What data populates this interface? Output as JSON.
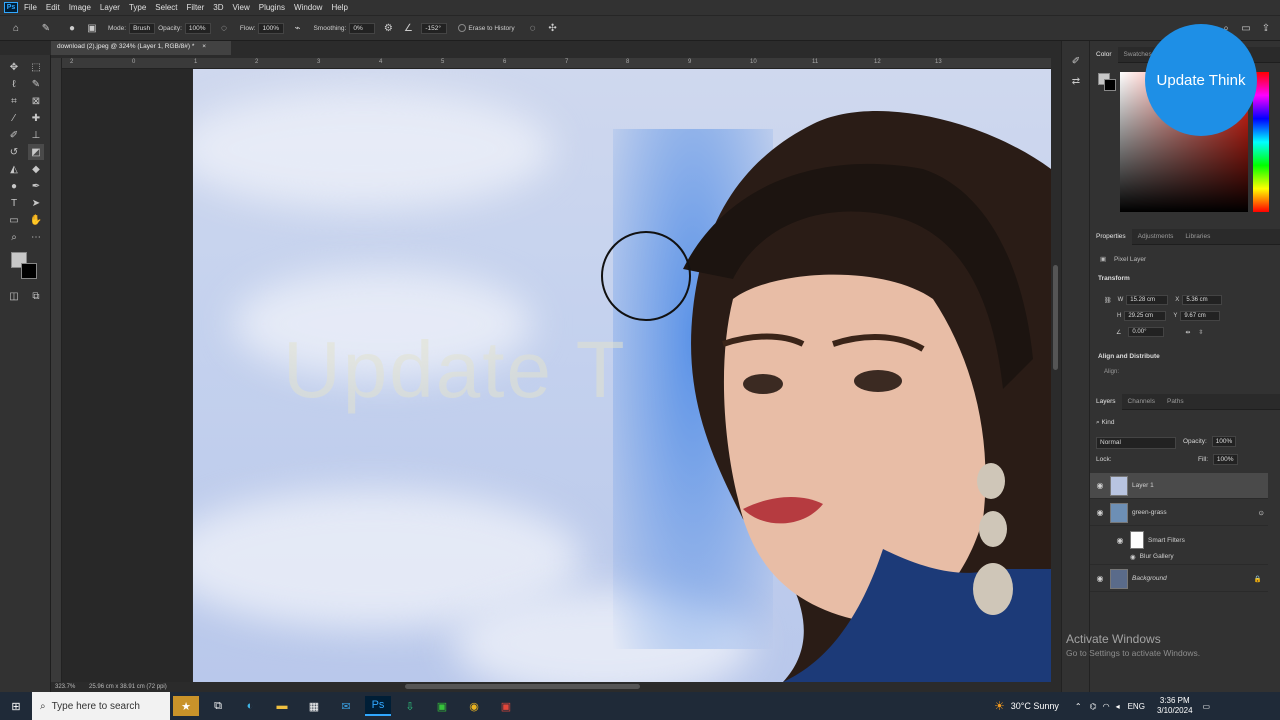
{
  "menu": [
    "File",
    "Edit",
    "Image",
    "Layer",
    "Type",
    "Select",
    "Filter",
    "3D",
    "View",
    "Plugins",
    "Window",
    "Help"
  ],
  "options": {
    "mode_label": "Mode:",
    "mode_value": "Brush",
    "opacity_label": "Opacity:",
    "opacity_value": "100%",
    "flow_label": "Flow:",
    "flow_value": "100%",
    "smoothing_label": "Smoothing:",
    "smoothing_value": "0%",
    "angle_value": "-152°",
    "erase_history": "Erase to History"
  },
  "document": {
    "tab_title": "download (2).jpeg @ 324% (Layer 1, RGB/8#) *",
    "zoom": "323.7%",
    "size": "25.96 cm x 38.91 cm (72 ppi)"
  },
  "ruler_labels": [
    "2",
    "0",
    "1",
    "2",
    "3",
    "4",
    "5",
    "6",
    "7",
    "8",
    "9",
    "10",
    "11",
    "12",
    "13"
  ],
  "watermark": "Update T",
  "badge": "Update Think",
  "color_tabs": [
    "Color",
    "Swatches"
  ],
  "properties": {
    "tabs": [
      "Properties",
      "Adjustments",
      "Libraries"
    ],
    "layer_type": "Pixel Layer",
    "transform_title": "Transform",
    "w_label": "W",
    "w_value": "15.28 cm",
    "x_label": "X",
    "x_value": "5.36 cm",
    "h_label": "H",
    "h_value": "29.25 cm",
    "y_label": "Y",
    "y_value": "9.67 cm",
    "angle_value": "0.00°",
    "align_title": "Align and Distribute",
    "align_label": "Align:"
  },
  "layers_panel": {
    "tabs": [
      "Layers",
      "Channels",
      "Paths"
    ],
    "filter": "Kind",
    "blend": "Normal",
    "opacity_label": "Opacity:",
    "opacity_value": "100%",
    "lock_label": "Lock:",
    "fill_label": "Fill:",
    "fill_value": "100%",
    "layers": [
      {
        "name": "Layer 1"
      },
      {
        "name": "green-grass"
      },
      {
        "name": "Smart Filters"
      },
      {
        "name": "Blur Gallery"
      },
      {
        "name": "Background"
      }
    ]
  },
  "windows_notice": {
    "title": "Activate Windows",
    "subtitle": "Go to Settings to activate Windows."
  },
  "taskbar": {
    "search_placeholder": "Type here to search",
    "weather": "30°C  Sunny",
    "lang": "ENG",
    "time": "3:36 PM",
    "date": "3/10/2024"
  }
}
